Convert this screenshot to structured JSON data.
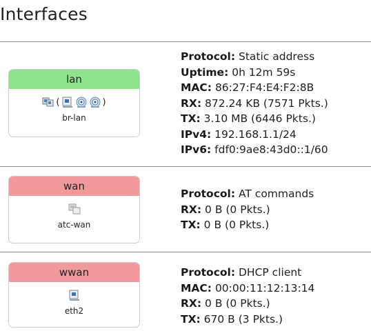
{
  "page": {
    "title": "Interfaces"
  },
  "interfaces": [
    {
      "name": "lan",
      "status": "up",
      "device": "br-lan",
      "icons": [
        "bridge-icon",
        "ethernet-port-icon",
        "wifi-icon",
        "wifi-icon"
      ],
      "paren_open": "(",
      "paren_close": ")",
      "fields": [
        {
          "label": "Protocol:",
          "value": "Static address"
        },
        {
          "label": "Uptime:",
          "value": "0h 12m 59s"
        },
        {
          "label": "MAC:",
          "value": "86:27:F4:E4:F2:8B"
        },
        {
          "label": "RX:",
          "value": "872.24 KB (7571 Pkts.)"
        },
        {
          "label": "TX:",
          "value": "3.10 MB (6446 Pkts.)"
        },
        {
          "label": "IPv4:",
          "value": "192.168.1.1/24"
        },
        {
          "label": "IPv6:",
          "value": "fdf0:9ae8:43d0::1/60"
        }
      ]
    },
    {
      "name": "wan",
      "status": "down",
      "device": "atc-wan",
      "icons": [
        "virtual-device-icon"
      ],
      "fields": [
        {
          "label": "Protocol:",
          "value": "AT commands"
        },
        {
          "label": "RX:",
          "value": "0 B (0 Pkts.)"
        },
        {
          "label": "TX:",
          "value": "0 B (0 Pkts.)"
        }
      ]
    },
    {
      "name": "wwan",
      "status": "down",
      "device": "eth2",
      "icons": [
        "ethernet-port-icon"
      ],
      "fields": [
        {
          "label": "Protocol:",
          "value": "DHCP client"
        },
        {
          "label": "MAC:",
          "value": "00:00:11:12:13:14"
        },
        {
          "label": "RX:",
          "value": "0 B (0 Pkts.)"
        },
        {
          "label": "TX:",
          "value": "670 B (3 Pkts.)"
        }
      ]
    }
  ],
  "colors": {
    "up": "#8fe38b",
    "down": "#f1999b",
    "border": "#c6cdd3"
  }
}
